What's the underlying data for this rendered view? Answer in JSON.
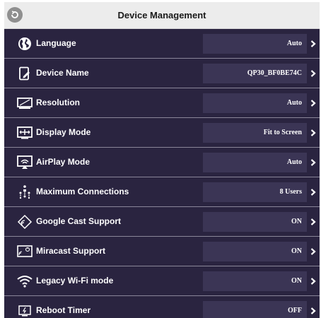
{
  "header": {
    "title": "Device Management",
    "back_icon": "back-circle-icon"
  },
  "colors": {
    "panel_background": "#2a2440",
    "value_box": "#3b3555",
    "divider": "#8a8699",
    "header_background": "#ececec",
    "text": "#ffffff"
  },
  "settings": [
    {
      "key": "language",
      "label": "Language",
      "value": "Auto",
      "icon": "globe-icon"
    },
    {
      "key": "device-name",
      "label": "Device Name",
      "value": "QP30_BF0BE74C",
      "icon": "device-edit-icon"
    },
    {
      "key": "resolution",
      "label": "Resolution",
      "value": "Auto",
      "icon": "monitor-icon"
    },
    {
      "key": "display-mode",
      "label": "Display Mode",
      "value": "Fit to Screen",
      "icon": "fit-screen-icon"
    },
    {
      "key": "airplay-mode",
      "label": "AirPlay Mode",
      "value": "Auto",
      "icon": "airplay-icon"
    },
    {
      "key": "maximum-connections",
      "label": "Maximum Connections",
      "value": "8 Users",
      "icon": "users-network-icon"
    },
    {
      "key": "google-cast-support",
      "label": "Google Cast Support",
      "value": "ON",
      "icon": "cast-icon"
    },
    {
      "key": "miracast-support",
      "label": "Miracast Support",
      "value": "ON",
      "icon": "miracast-icon"
    },
    {
      "key": "legacy-wifi-mode",
      "label": "Legacy Wi-Fi mode",
      "value": "ON",
      "icon": "wifi-icon"
    },
    {
      "key": "reboot-timer",
      "label": "Reboot Timer",
      "value": "OFF",
      "icon": "reboot-timer-icon"
    }
  ]
}
